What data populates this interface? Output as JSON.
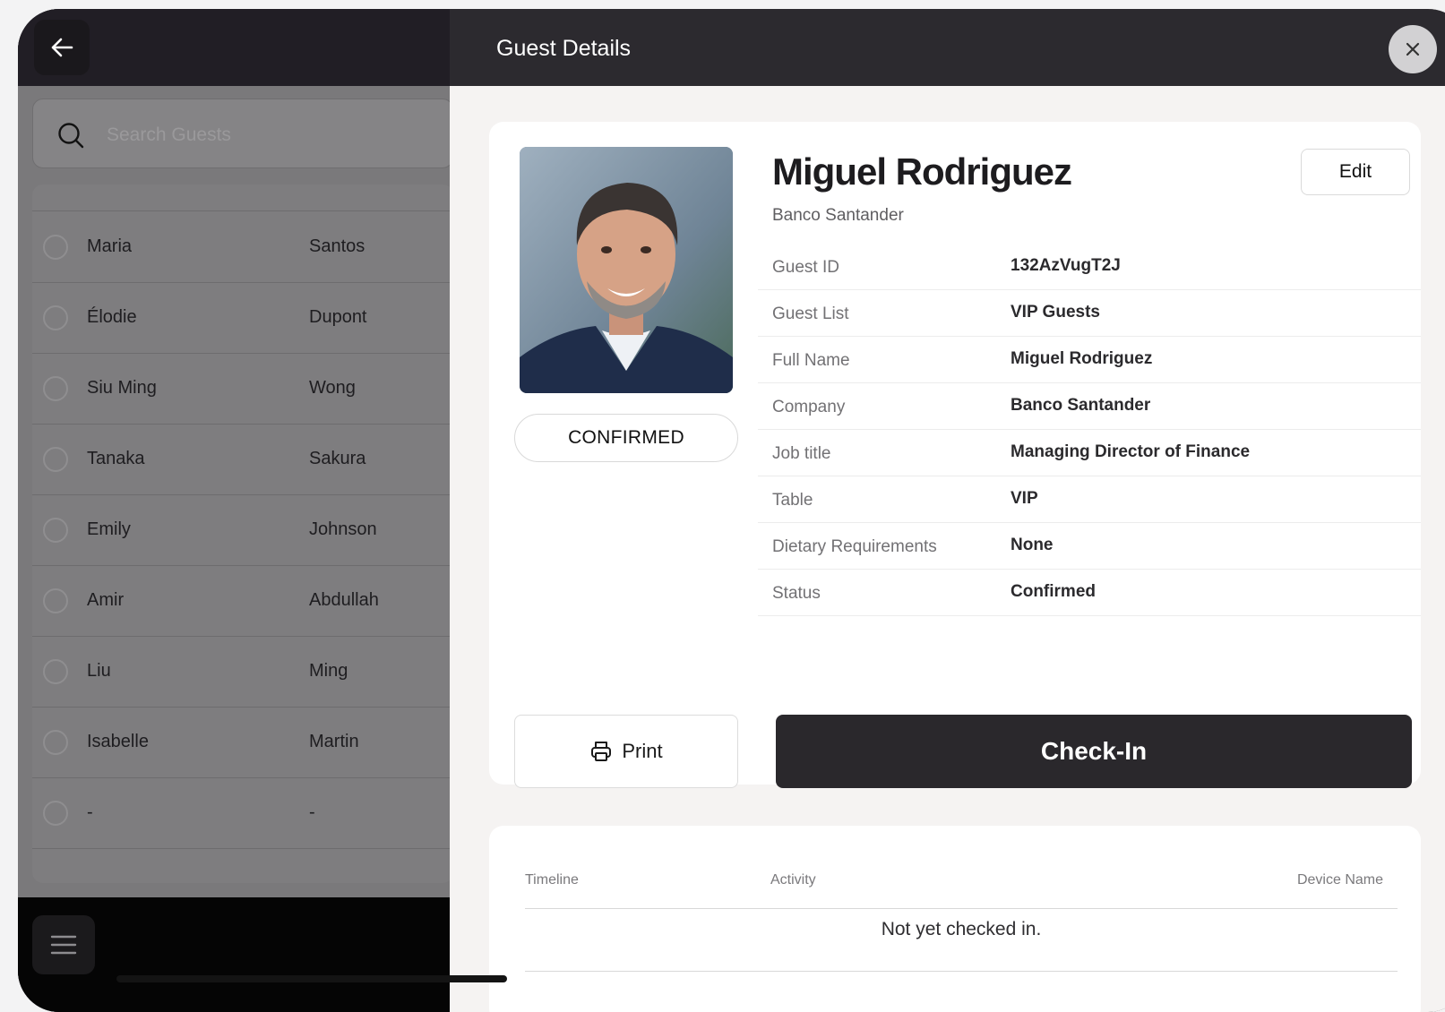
{
  "left": {
    "search_placeholder": "Search Guests",
    "guests": [
      {
        "first": "Maria",
        "last": "Santos"
      },
      {
        "first": "Élodie",
        "last": "Dupont"
      },
      {
        "first": "Siu Ming",
        "last": "Wong"
      },
      {
        "first": "Tanaka",
        "last": "Sakura"
      },
      {
        "first": "Emily",
        "last": "Johnson"
      },
      {
        "first": "Amir",
        "last": "Abdullah"
      },
      {
        "first": "Liu",
        "last": "Ming"
      },
      {
        "first": "Isabelle",
        "last": "Martin"
      },
      {
        "first": "-",
        "last": "-"
      }
    ]
  },
  "header": {
    "title": "Guest Details"
  },
  "guest": {
    "name": "Miguel Rodriguez",
    "company": "Banco Santander",
    "status_pill": "CONFIRMED",
    "edit_label": "Edit",
    "details": [
      {
        "label": "Guest ID",
        "value": "132AzVugT2J"
      },
      {
        "label": "Guest List",
        "value": "VIP Guests"
      },
      {
        "label": "Full Name",
        "value": "Miguel Rodriguez"
      },
      {
        "label": "Company",
        "value": "Banco Santander"
      },
      {
        "label": "Job title",
        "value": "Managing Director of Finance"
      },
      {
        "label": "Table",
        "value": "VIP"
      },
      {
        "label": "Dietary Requirements",
        "value": "None"
      },
      {
        "label": "Status",
        "value": "Confirmed"
      }
    ]
  },
  "actions": {
    "print_label": "Print",
    "checkin_label": "Check-In"
  },
  "timeline": {
    "col_timeline": "Timeline",
    "col_activity": "Activity",
    "col_device": "Device Name",
    "empty_text": "Not yet checked in."
  },
  "colors": {
    "dark_header": "#2c2a2f",
    "checkin_button": "#2a282c",
    "overlay": "#7a797b"
  },
  "icons": [
    "back-arrow-icon",
    "search-icon",
    "menu-icon",
    "close-icon",
    "printer-icon",
    "check-circle-icon"
  ]
}
